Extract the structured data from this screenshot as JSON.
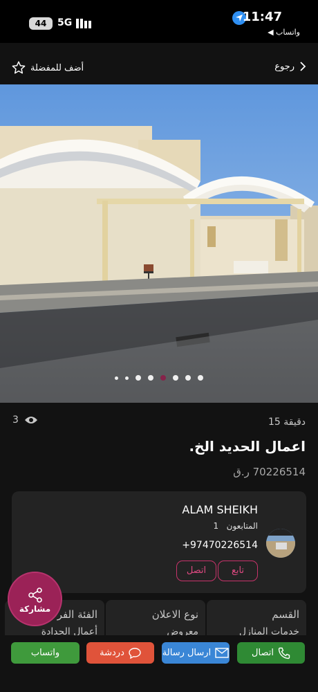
{
  "status_bar": {
    "time": "11:47",
    "back_app": "◀ واتساب",
    "battery": "44",
    "network": "5G"
  },
  "top_bar": {
    "favorite_label": "أضف للمفضلة",
    "back_label": "رجوع"
  },
  "gallery": {
    "image_count": 7,
    "active_index": 5
  },
  "listing": {
    "views": "3",
    "time_ago": "15 دقيقة",
    "title": "اعمال الحديد الخ.",
    "price": "70226514 ر.ق"
  },
  "seller": {
    "name": "ALAM SHEIKH",
    "followers_label": "المتابعون",
    "followers_count": "1",
    "phone": "+97470226514",
    "follow_label": "تابع",
    "call_label": "اتصل"
  },
  "categories": [
    {
      "key": "القسم",
      "value": "خدمات المنازل"
    },
    {
      "key": "نوع الاعلان",
      "value": "معروض"
    },
    {
      "key": "الفئة الفرعية",
      "value": "أعمال الحدادة"
    }
  ],
  "share_label": "مشاركة",
  "bottom_bar": {
    "whatsapp_label": "واتساب",
    "chat_label": "دردشة",
    "message_label": "ارسال رسالة",
    "call_label": "اتصال"
  },
  "colors": {
    "accent": "#9b2257",
    "whatsapp": "#3f9a3c",
    "chat": "#e0533a",
    "message": "#3a86d6",
    "call": "#2f8a34"
  }
}
